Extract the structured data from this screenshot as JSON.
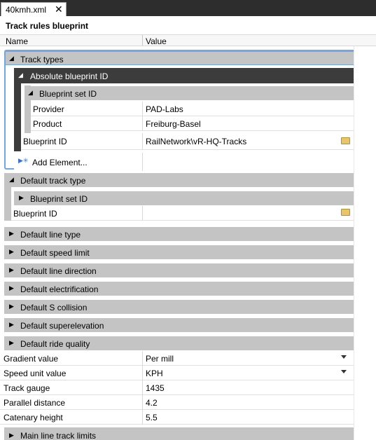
{
  "tab": {
    "label": "40kmh.xml",
    "close": "✕"
  },
  "title": "Track rules blueprint",
  "header": {
    "name": "Name",
    "value": "Value"
  },
  "groups": {
    "track_types": "Track types",
    "absolute_blueprint_id": "Absolute blueprint ID",
    "blueprint_set_id": "Blueprint set ID",
    "default_track_type": "Default track type",
    "blueprint_set_id_2": "Blueprint set ID",
    "default_line_type": "Default line type",
    "default_speed_limit": "Default speed limit",
    "default_line_direction": "Default line direction",
    "default_electrification": "Default electrification",
    "default_s_collision": "Default S collision",
    "default_superelevation": "Default superelevation",
    "default_ride_quality": "Default ride quality",
    "main_line_track_limits": "Main line track limits"
  },
  "rows": {
    "provider": {
      "name": "Provider",
      "value": "PAD-Labs"
    },
    "product": {
      "name": "Product",
      "value": "Freiburg-Basel"
    },
    "blueprint_id": {
      "name": "Blueprint ID",
      "value": "RailNetwork\\vR-HQ-Tracks"
    },
    "add_element": {
      "name": "Add Element..."
    },
    "blueprint_id_2": {
      "name": "Blueprint ID",
      "value": ""
    },
    "gradient": {
      "name": "Gradient value",
      "value": "Per mill"
    },
    "speed_unit": {
      "name": "Speed unit value",
      "value": "KPH"
    },
    "track_gauge": {
      "name": "Track gauge",
      "value": "1435"
    },
    "parallel_distance": {
      "name": "Parallel distance",
      "value": "4.2"
    },
    "catenary_height": {
      "name": "Catenary height",
      "value": "5.5"
    }
  },
  "colors": {
    "selection_border": "#6ea6e8",
    "group_bg": "#c4c4c4",
    "dark_group_bg": "#3c3c3c"
  }
}
